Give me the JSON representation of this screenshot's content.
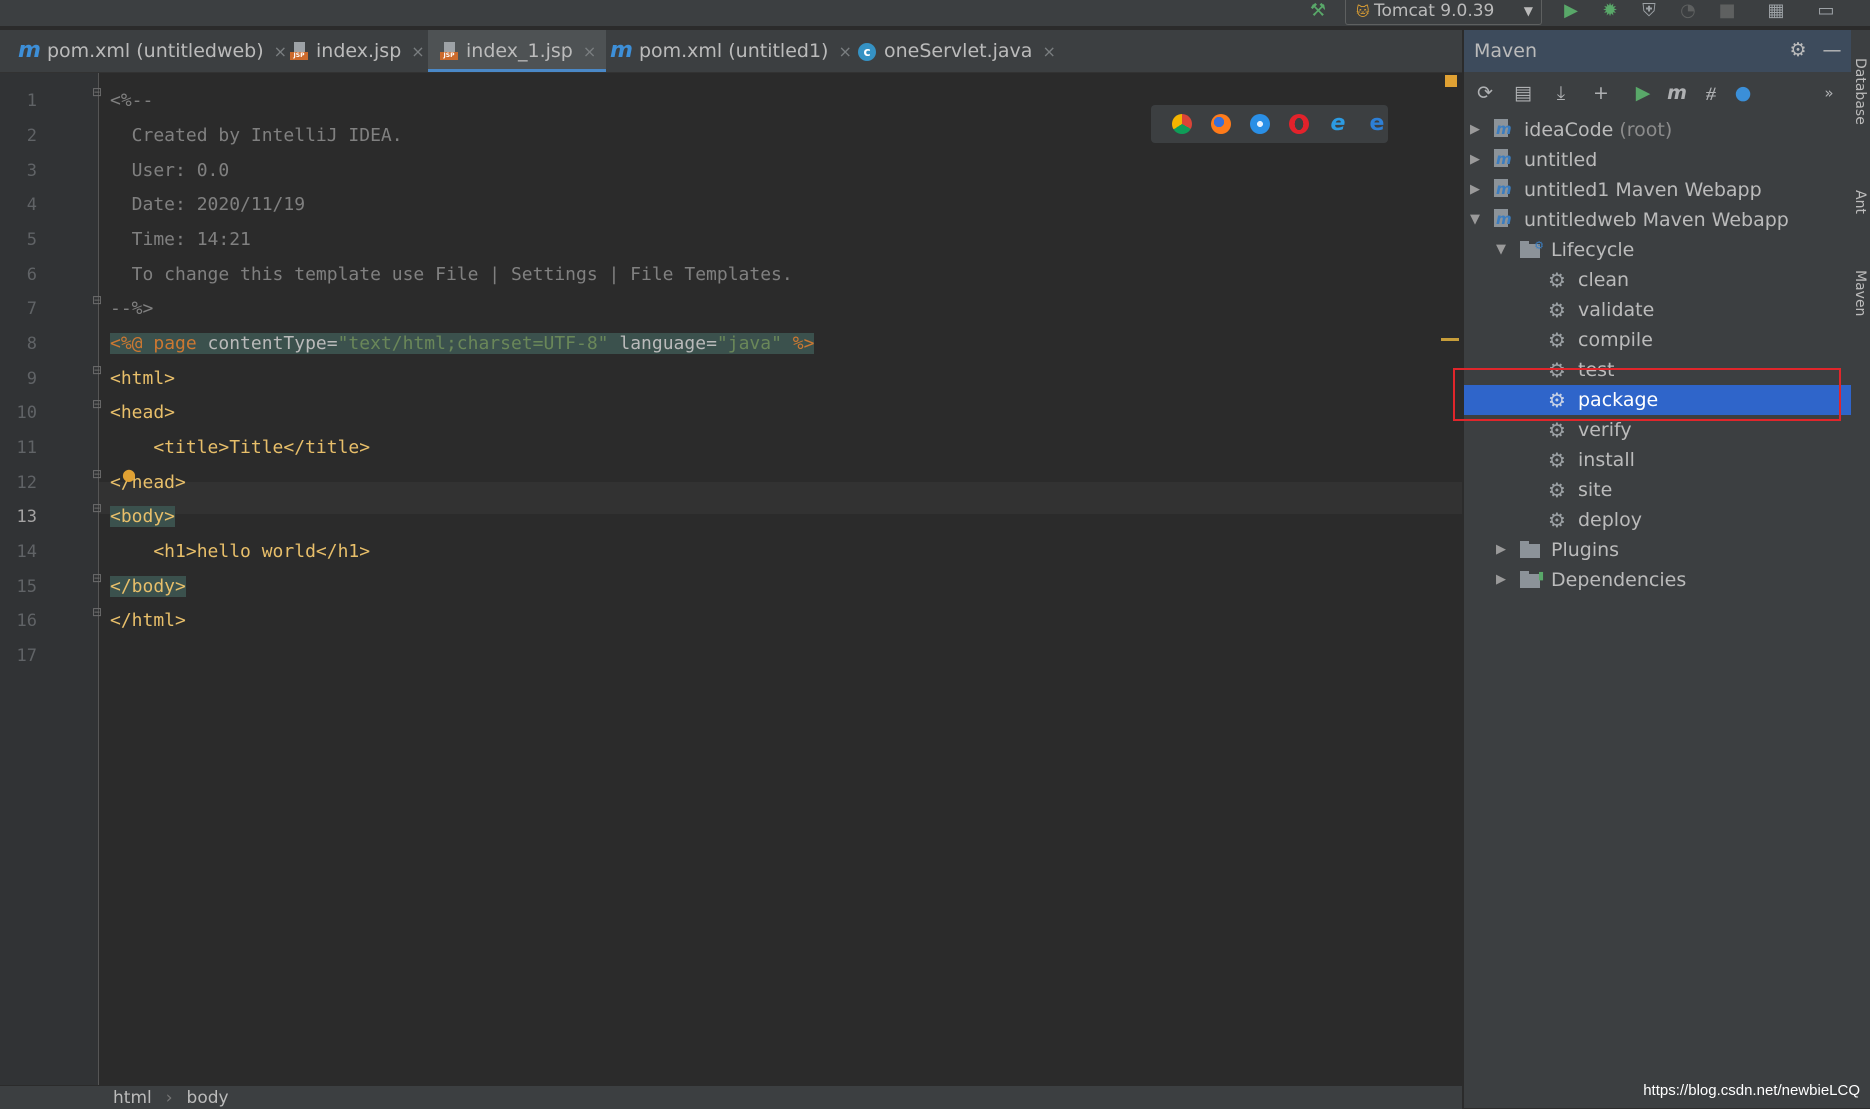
{
  "toolbar": {
    "run_config": "Tomcat 9.0.39",
    "icons": [
      "build-hammer-icon",
      "run-icon",
      "debug-icon",
      "coverage-icon",
      "profile-icon",
      "stop-icon",
      "project-structure-icon",
      "terminal-icon"
    ]
  },
  "tabs": [
    {
      "label": "pom.xml (untitledweb)",
      "icon": "maven-icon",
      "active": false
    },
    {
      "label": "index.jsp",
      "icon": "jsp-icon",
      "active": false
    },
    {
      "label": "index_1.jsp",
      "icon": "jsp-icon",
      "active": true
    },
    {
      "label": "pom.xml (untitled1)",
      "icon": "maven-icon",
      "active": false
    },
    {
      "label": "oneServlet.java",
      "icon": "class-icon",
      "active": false
    }
  ],
  "tab_icon_glyphs": {
    "maven": "m",
    "jsp": "JSP",
    "class": "c"
  },
  "tab_close": "×",
  "editor": {
    "current_line": 13,
    "lines": [
      {
        "n": "1",
        "text": "<%--"
      },
      {
        "n": "2",
        "text": "  Created by IntelliJ IDEA."
      },
      {
        "n": "3",
        "text": "  User: 0.0"
      },
      {
        "n": "4",
        "text": "  Date: 2020/11/19"
      },
      {
        "n": "5",
        "text": "  Time: 14:21"
      },
      {
        "n": "6",
        "text": "  To change this template use File | Settings | File Templates."
      },
      {
        "n": "7",
        "text": "--%>"
      },
      {
        "n": "8",
        "t1": "<%@ ",
        "t2": "page ",
        "t3": "contentType=",
        "t4": "\"text/html;charset=UTF-8\"",
        "t5": " language=",
        "t6": "\"java\"",
        "t7": " %>"
      },
      {
        "n": "9",
        "text": "<html>"
      },
      {
        "n": "10",
        "text": "<head>"
      },
      {
        "n": "11",
        "text": "    <title>Title</title>"
      },
      {
        "n": "12",
        "text": "</head>"
      },
      {
        "n": "13",
        "text": "<body>"
      },
      {
        "n": "14",
        "text": "    <h1>hello world</h1>"
      },
      {
        "n": "15",
        "text": "</body>"
      },
      {
        "n": "16",
        "text": "</html>"
      },
      {
        "n": "17",
        "text": ""
      }
    ]
  },
  "browser_icons": [
    "chrome-icon",
    "firefox-icon",
    "safari-icon",
    "opera-icon",
    "ie-icon",
    "edge-icon"
  ],
  "breadcrumb": [
    "html",
    "body"
  ],
  "breadcrumb_sep": "›",
  "maven": {
    "title": "Maven",
    "toolbar_icons": [
      "reload-icon",
      "generate-sources-icon",
      "download-icon",
      "add-icon",
      "run-icon",
      "execute-goal-icon",
      "skip-tests-icon",
      "offline-icon",
      "more-icon"
    ],
    "tree": [
      {
        "label": "ideaCode",
        "suffix": "(root)",
        "type": "project",
        "expanded": false
      },
      {
        "label": "untitled",
        "suffix": "",
        "type": "project",
        "expanded": false
      },
      {
        "label": "untitled1 Maven Webapp",
        "suffix": "",
        "type": "project",
        "expanded": false
      },
      {
        "label": "untitledweb Maven Webapp",
        "suffix": "",
        "type": "project",
        "expanded": true
      },
      {
        "label": "Lifecycle",
        "type": "folder",
        "expanded": true
      },
      {
        "label": "clean",
        "type": "goal"
      },
      {
        "label": "validate",
        "type": "goal"
      },
      {
        "label": "compile",
        "type": "goal"
      },
      {
        "label": "test",
        "type": "goal"
      },
      {
        "label": "package",
        "type": "goal",
        "selected": true
      },
      {
        "label": "verify",
        "type": "goal"
      },
      {
        "label": "install",
        "type": "goal"
      },
      {
        "label": "site",
        "type": "goal"
      },
      {
        "label": "deploy",
        "type": "goal"
      },
      {
        "label": "Plugins",
        "type": "folder",
        "expanded": false
      },
      {
        "label": "Dependencies",
        "type": "folder",
        "expanded": false
      }
    ]
  },
  "side_tabs": [
    "Database",
    "Ant",
    "Maven"
  ],
  "watermark": "https://blog.csdn.net/newbieLCQ"
}
